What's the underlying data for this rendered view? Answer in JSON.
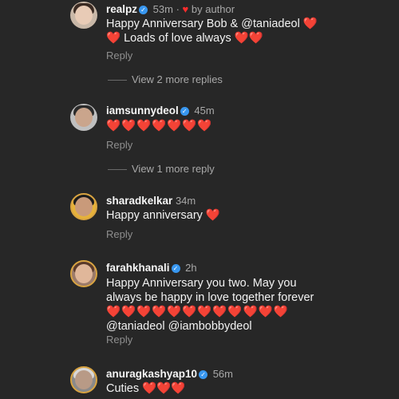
{
  "comments": [
    {
      "username": "realpz",
      "time": "53m",
      "author_badge": "by author",
      "text_line1": "Happy Anniversary Bob & @taniadeol ❤️",
      "text_line2": "❤️ Loads of love always ❤️❤️",
      "reply_label": "Reply",
      "view_more": "View 2 more replies"
    },
    {
      "username": "iamsunnydeol",
      "time": "45m",
      "text_line1": "❤️❤️❤️❤️❤️❤️❤️",
      "reply_label": "Reply",
      "view_more": "View 1 more reply"
    },
    {
      "username": "sharadkelkar",
      "time": "34m",
      "text_line1": "Happy anniversary ❤️",
      "reply_label": "Reply"
    },
    {
      "username": "farahkhanali",
      "time": "2h",
      "text_line1": "Happy Anniversary you two. May you",
      "text_line2": "always be happy in love together forever",
      "text_line3": "❤️❤️❤️❤️❤️❤️❤️❤️❤️❤️❤️❤️",
      "text_line4": "@taniadeol @iambobbydeol",
      "reply_label": "Reply"
    },
    {
      "username": "anuragkashyap10",
      "time": "56m",
      "text_line1": "Cuties ❤️❤️❤️"
    }
  ],
  "icons": {
    "verified": "verified-badge-icon",
    "heart": "heart-icon"
  },
  "colors": {
    "background": "#272727",
    "verified": "#3897f0",
    "heart": "#ff2d2d",
    "story_ring": "#d9a441"
  }
}
